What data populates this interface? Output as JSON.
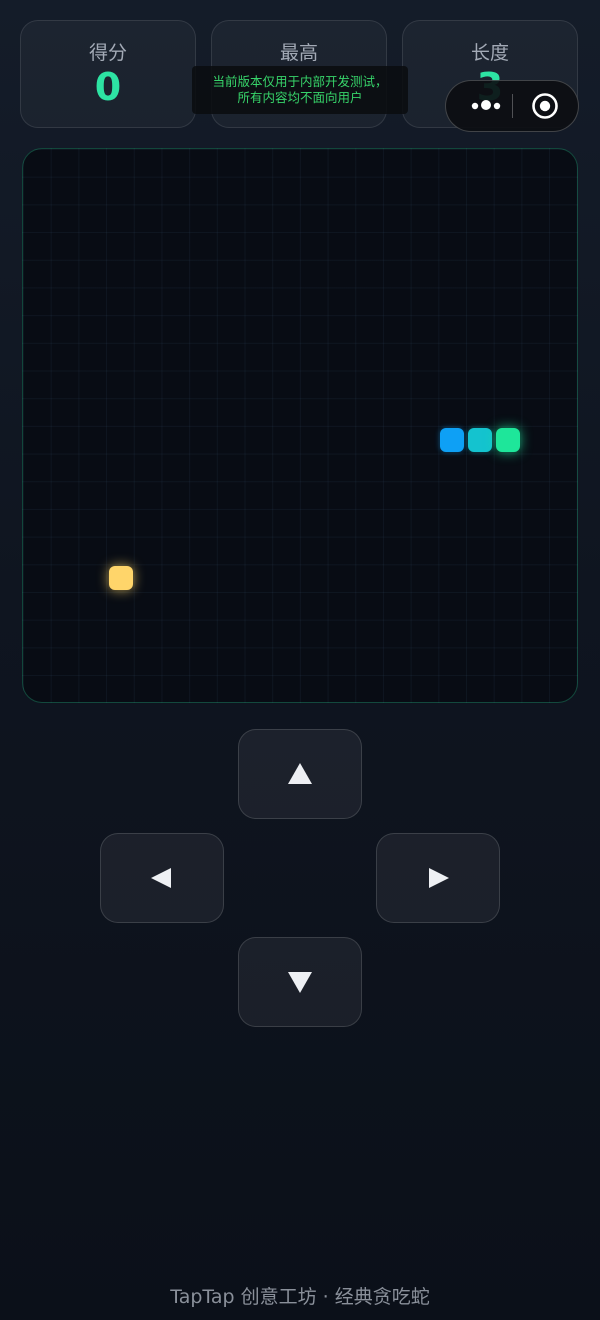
{
  "stats": {
    "score": {
      "label": "得分",
      "value": "0"
    },
    "high": {
      "label": "最高",
      "value": ""
    },
    "length": {
      "label": "长度",
      "value": "3"
    }
  },
  "dev_toast": {
    "line1": "当前版本仅用于内部开发测试，",
    "line2": "所有内容均不面向用户"
  },
  "capsule": {
    "more_icon": "more-dots-icon",
    "close_icon": "target-circle-icon"
  },
  "board": {
    "snake_colors": {
      "head": "#1ee69a",
      "body": "#14c3cf",
      "tail": "#0ea0f5"
    },
    "food_color": "#ffd56a",
    "accent": "#2de3a3"
  },
  "controls": {
    "up_icon": "arrow-up-icon",
    "down_icon": "arrow-down-icon",
    "left_icon": "arrow-left-icon",
    "right_icon": "arrow-right-icon"
  },
  "footer": {
    "text": "TapTap 创意工坊 · 经典贪吃蛇"
  }
}
